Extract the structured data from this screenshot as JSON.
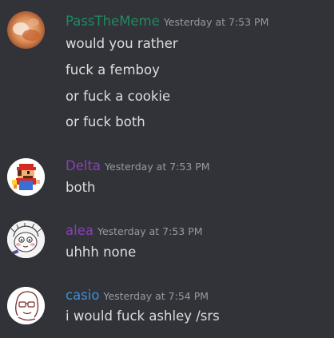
{
  "messages": [
    {
      "username": "PassTheMeme",
      "username_color": "#1f8b5f",
      "avatar": "orange-blurry-avatar",
      "timestamp": "Yesterday at 7:53 PM",
      "lines": [
        "would you rather",
        "fuck a femboy",
        "or fuck a cookie",
        "or fuck both"
      ]
    },
    {
      "username": "Delta",
      "username_color": "#8a3fb5",
      "avatar": "pixel-mario-avatar",
      "timestamp": "Yesterday at 7:53 PM",
      "lines": [
        "both"
      ]
    },
    {
      "username": "alea",
      "username_color": "#8a3fb5",
      "avatar": "sketch-face-avatar",
      "timestamp": "Yesterday at 7:53 PM",
      "lines": [
        "uhhh none"
      ]
    },
    {
      "username": "casio",
      "username_color": "#3b8fd9",
      "avatar": "glasses-sketch-avatar",
      "timestamp": "Yesterday at 7:54 PM",
      "lines": [
        "i would fuck ashley /srs"
      ]
    }
  ]
}
